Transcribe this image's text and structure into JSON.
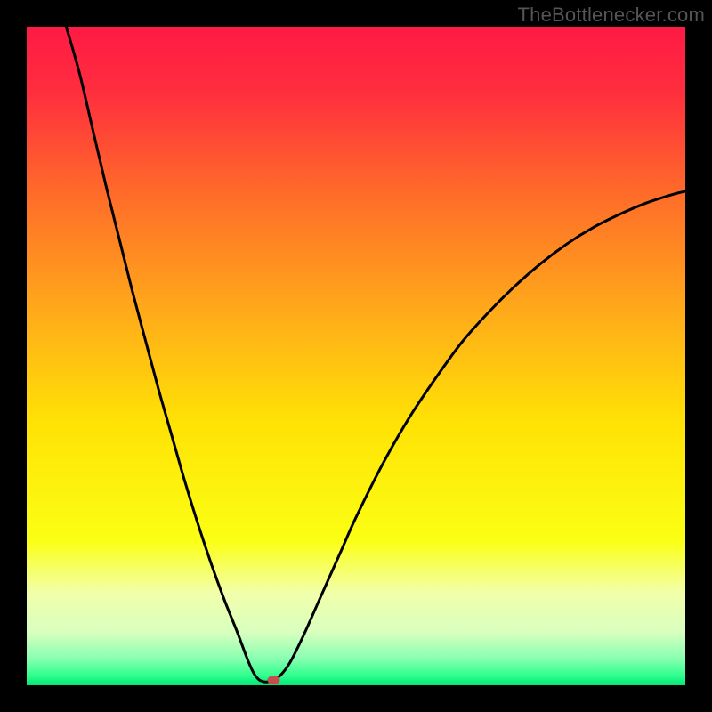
{
  "watermark": "TheBottlenecker.com",
  "chart_data": {
    "type": "line",
    "title": "",
    "xlabel": "",
    "ylabel": "",
    "xlim": [
      0,
      100
    ],
    "ylim": [
      0,
      100
    ],
    "gradient_stops": [
      {
        "offset": 0.0,
        "color": "#ff1a44"
      },
      {
        "offset": 0.1,
        "color": "#ff2e3e"
      },
      {
        "offset": 0.25,
        "color": "#ff6a2a"
      },
      {
        "offset": 0.45,
        "color": "#ffb018"
      },
      {
        "offset": 0.6,
        "color": "#ffe205"
      },
      {
        "offset": 0.78,
        "color": "#fbff14"
      },
      {
        "offset": 0.86,
        "color": "#f2ffab"
      },
      {
        "offset": 0.92,
        "color": "#d8ffbf"
      },
      {
        "offset": 0.96,
        "color": "#87ffb0"
      },
      {
        "offset": 0.985,
        "color": "#30ff8d"
      },
      {
        "offset": 1.0,
        "color": "#00e676"
      }
    ],
    "curve": [
      {
        "x": 6.0,
        "y": 100.0
      },
      {
        "x": 8.0,
        "y": 93.0
      },
      {
        "x": 10.0,
        "y": 84.5
      },
      {
        "x": 12.0,
        "y": 76.0
      },
      {
        "x": 14.0,
        "y": 68.0
      },
      {
        "x": 16.0,
        "y": 60.0
      },
      {
        "x": 18.0,
        "y": 52.5
      },
      {
        "x": 20.0,
        "y": 45.0
      },
      {
        "x": 22.0,
        "y": 38.0
      },
      {
        "x": 24.0,
        "y": 31.0
      },
      {
        "x": 26.0,
        "y": 24.5
      },
      {
        "x": 28.0,
        "y": 18.5
      },
      {
        "x": 30.0,
        "y": 13.0
      },
      {
        "x": 32.0,
        "y": 8.0
      },
      {
        "x": 33.5,
        "y": 4.0
      },
      {
        "x": 34.5,
        "y": 1.8
      },
      {
        "x": 35.5,
        "y": 0.7
      },
      {
        "x": 37.0,
        "y": 0.6
      },
      {
        "x": 38.5,
        "y": 1.5
      },
      {
        "x": 40.0,
        "y": 3.5
      },
      {
        "x": 42.0,
        "y": 7.5
      },
      {
        "x": 44.0,
        "y": 12.0
      },
      {
        "x": 46.0,
        "y": 16.5
      },
      {
        "x": 48.0,
        "y": 21.0
      },
      {
        "x": 50.0,
        "y": 25.5
      },
      {
        "x": 54.0,
        "y": 33.5
      },
      {
        "x": 58.0,
        "y": 40.5
      },
      {
        "x": 62.0,
        "y": 46.5
      },
      {
        "x": 66.0,
        "y": 52.0
      },
      {
        "x": 70.0,
        "y": 56.5
      },
      {
        "x": 74.0,
        "y": 60.5
      },
      {
        "x": 78.0,
        "y": 64.0
      },
      {
        "x": 82.0,
        "y": 67.0
      },
      {
        "x": 86.0,
        "y": 69.5
      },
      {
        "x": 90.0,
        "y": 71.5
      },
      {
        "x": 94.0,
        "y": 73.2
      },
      {
        "x": 98.0,
        "y": 74.5
      },
      {
        "x": 100.0,
        "y": 75.0
      }
    ],
    "marker": {
      "x": 37.5,
      "y": 0.8,
      "rx": 7,
      "ry": 5,
      "color": "#c54d4d"
    }
  }
}
